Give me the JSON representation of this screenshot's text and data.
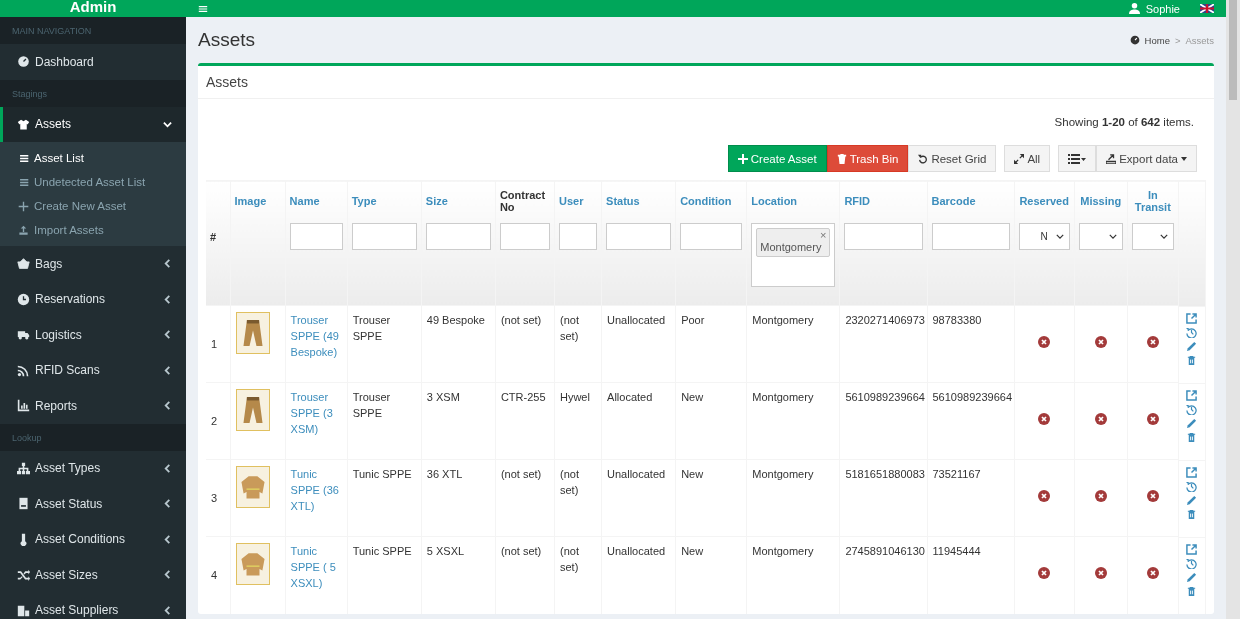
{
  "brand": "Admin",
  "user": {
    "name": "Sophie"
  },
  "sidebar": {
    "sections": [
      {
        "header": "MAIN NAVIGATION",
        "items": [
          {
            "label": "Dashboard",
            "kind": "link",
            "selected": false
          }
        ]
      },
      {
        "header": "Stagings",
        "items": [
          {
            "label": "Assets",
            "kind": "menu",
            "selected": true,
            "expanded": true,
            "children": [
              {
                "label": "Asset List",
                "selected": true
              },
              {
                "label": "Undetected Asset List",
                "selected": false
              },
              {
                "label": "Create New Asset",
                "selected": false
              },
              {
                "label": "Import Assets",
                "selected": false
              }
            ]
          },
          {
            "label": "Bags",
            "kind": "menu",
            "selected": false,
            "expanded": false
          },
          {
            "label": "Reservations",
            "kind": "menu",
            "selected": false,
            "expanded": false
          },
          {
            "label": "Logistics",
            "kind": "menu",
            "selected": false,
            "expanded": false
          },
          {
            "label": "RFID Scans",
            "kind": "menu",
            "selected": false,
            "expanded": false
          },
          {
            "label": "Reports",
            "kind": "menu",
            "selected": false,
            "expanded": false
          }
        ]
      },
      {
        "header": "Lookup",
        "items": [
          {
            "label": "Asset Types",
            "kind": "menu",
            "selected": false,
            "expanded": false
          },
          {
            "label": "Asset Status",
            "kind": "menu",
            "selected": false,
            "expanded": false
          },
          {
            "label": "Asset Conditions",
            "kind": "menu",
            "selected": false,
            "expanded": false
          },
          {
            "label": "Asset Sizes",
            "kind": "menu",
            "selected": false,
            "expanded": false
          },
          {
            "label": "Asset Suppliers",
            "kind": "menu",
            "selected": false,
            "expanded": false
          }
        ]
      }
    ]
  },
  "page": {
    "title": "Assets",
    "breadcrumb": [
      "Home",
      "Assets"
    ],
    "breadcrumb_separator": ">"
  },
  "box": {
    "title": "Assets",
    "summary": "Showing **1-20** of **642** items."
  },
  "toolbar": [
    {
      "label": "Create Asset",
      "kind": "create"
    },
    {
      "label": "Trash Bin",
      "kind": "trash"
    },
    {
      "label": "Reset Grid",
      "kind": "reset"
    },
    {
      "label": "All",
      "kind": "expand"
    },
    {
      "kind": "columns"
    },
    {
      "label": "Export data",
      "kind": "export"
    }
  ],
  "table": {
    "columns": [
      {
        "label": "#",
        "sortable": false,
        "filter": {
          "kind": "none"
        }
      },
      {
        "label": "Image",
        "sortable": true,
        "filter": {
          "kind": "none"
        }
      },
      {
        "label": "Name",
        "sortable": true,
        "filter": {
          "kind": "text"
        }
      },
      {
        "label": "Type",
        "sortable": true,
        "filter": {
          "kind": "text"
        }
      },
      {
        "label": "Size",
        "sortable": true,
        "filter": {
          "kind": "text"
        }
      },
      {
        "label": "Contract No",
        "sortable": false,
        "filter": {
          "kind": "text"
        }
      },
      {
        "label": "User",
        "sortable": true,
        "filter": {
          "kind": "text"
        }
      },
      {
        "label": "Status",
        "sortable": true,
        "filter": {
          "kind": "text"
        }
      },
      {
        "label": "Condition",
        "sortable": true,
        "filter": {
          "kind": "text"
        }
      },
      {
        "label": "Location",
        "sortable": true,
        "filter": {
          "kind": "tags",
          "tags": [
            "Montgomery"
          ],
          "remove_symbol": "×"
        }
      },
      {
        "label": "RFID",
        "sortable": true,
        "filter": {
          "kind": "text"
        }
      },
      {
        "label": "Barcode",
        "sortable": true,
        "filter": {
          "kind": "text"
        }
      },
      {
        "label": "Reserved",
        "sortable": true,
        "filter": {
          "kind": "select",
          "value": "N"
        }
      },
      {
        "label": "Missing",
        "sortable": true,
        "filter": {
          "kind": "select"
        }
      },
      {
        "label": "In Transit",
        "sortable": true,
        "filter": {
          "kind": "select"
        }
      },
      {
        "filter": {
          "kind": "none"
        }
      }
    ],
    "rows": [
      {
        "number": "1",
        "kind": "trouser",
        "name": "Trouser SPPE (49 Bespoke)",
        "type": "Trouser SPPE",
        "size": "49 Bespoke",
        "contract_no": "(not set)",
        "user": "(not set)",
        "status": "Unallocated",
        "condition": "Poor",
        "location": "Montgomery",
        "rfid": "2320271406973",
        "barcode": "98783380",
        "reserved": false,
        "missing": false,
        "in_transit": false
      },
      {
        "number": "2",
        "kind": "trouser",
        "name": "Trouser SPPE (3 XSM)",
        "type": "Trouser SPPE",
        "size": "3 XSM",
        "contract_no": "CTR-255",
        "user": "Hywel",
        "status": "Allocated",
        "condition": "New",
        "location": "Montgomery",
        "rfid": "5610989239664",
        "barcode": "5610989239664",
        "reserved": false,
        "missing": false,
        "in_transit": false
      },
      {
        "number": "3",
        "kind": "tunic",
        "name": "Tunic SPPE (36 XTL)",
        "type": "Tunic SPPE",
        "size": "36 XTL",
        "contract_no": "(not set)",
        "user": "(not set)",
        "status": "Unallocated",
        "condition": "New",
        "location": "Montgomery",
        "rfid": "5181651880083",
        "barcode": "73521167",
        "reserved": false,
        "missing": false,
        "in_transit": false
      },
      {
        "number": "4",
        "kind": "tunic",
        "name": "Tunic SPPE ( 5 XSXL)",
        "type": "Tunic SPPE",
        "size": "5 XSXL",
        "contract_no": "(not set)",
        "user": "(not set)",
        "status": "Unallocated",
        "condition": "New",
        "location": "Montgomery",
        "rfid": "2745891046130",
        "barcode": "11945444",
        "reserved": false,
        "missing": false,
        "in_transit": false
      }
    ]
  }
}
